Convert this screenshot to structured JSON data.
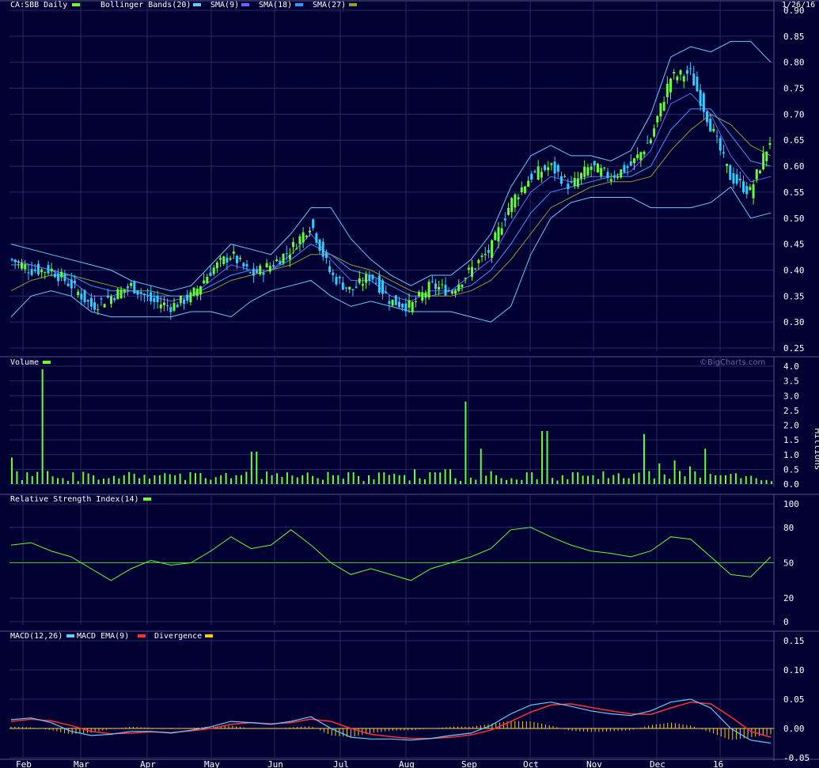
{
  "header": {
    "symbol_label": "CA:SBB Daily",
    "date": "1/26/16",
    "watermark": "©BigCharts.com"
  },
  "colors": {
    "background": "#000033",
    "grid": "#2a2a66",
    "separator": "#555588",
    "up": "#66ff33",
    "down": "#33ccff",
    "bollinger": "#66ccff",
    "sma9": "#6666ff",
    "sma18": "#3399ff",
    "sma27": "#999933",
    "volume": "#66ff33",
    "rsi": "#66ff33",
    "rsi_mid": "#33cc33",
    "macd": "#66ccff",
    "macd_ema": "#ff3333",
    "divergence": "#ffcc00"
  },
  "legends": {
    "price": [
      "Bollinger Bands(20)",
      "SMA(9)",
      "SMA(18)",
      "SMA(27)"
    ],
    "volume": "Volume",
    "rsi": "Relative Strength Index(14)",
    "macd": [
      "MACD(12,26)",
      "MACD EMA(9)",
      "Divergence"
    ],
    "volume_unit": "Millions"
  },
  "x_axis": {
    "months": [
      "Feb",
      "Mar",
      "Apr",
      "May",
      "Jun",
      "Jul",
      "Aug",
      "Sep",
      "Oct",
      "Nov",
      "Dec",
      "16"
    ]
  },
  "chart_data": [
    {
      "type": "line",
      "panel": "price",
      "title": "CA:SBB Daily",
      "x": [
        "Feb",
        "Mar",
        "Apr",
        "May",
        "Jun",
        "Jul",
        "Aug",
        "Sep",
        "Oct",
        "Nov",
        "Dec",
        "16"
      ],
      "ylim": [
        0.25,
        0.9
      ],
      "yticks": [
        "0.90",
        "0.85",
        "0.80",
        "0.75",
        "0.70",
        "0.65",
        "0.60",
        "0.55",
        "0.50",
        "0.45",
        "0.40",
        "0.35",
        "0.30",
        "0.25"
      ],
      "grid": true,
      "series": [
        {
          "name": "Close",
          "values": [
            0.42,
            0.4,
            0.4,
            0.37,
            0.33,
            0.35,
            0.37,
            0.34,
            0.33,
            0.35,
            0.4,
            0.43,
            0.39,
            0.41,
            0.44,
            0.49,
            0.39,
            0.36,
            0.39,
            0.34,
            0.33,
            0.37,
            0.36,
            0.4,
            0.44,
            0.53,
            0.58,
            0.6,
            0.56,
            0.6,
            0.58,
            0.6,
            0.65,
            0.77,
            0.78,
            0.68,
            0.58,
            0.55,
            0.65
          ]
        },
        {
          "name": "SMA(9)",
          "values": [
            0.42,
            0.41,
            0.4,
            0.38,
            0.35,
            0.35,
            0.36,
            0.35,
            0.34,
            0.35,
            0.38,
            0.41,
            0.4,
            0.4,
            0.43,
            0.47,
            0.42,
            0.38,
            0.38,
            0.35,
            0.34,
            0.36,
            0.36,
            0.39,
            0.42,
            0.49,
            0.55,
            0.58,
            0.57,
            0.58,
            0.58,
            0.59,
            0.63,
            0.72,
            0.74,
            0.7,
            0.62,
            0.57,
            0.58
          ]
        },
        {
          "name": "SMA(18)",
          "values": [
            0.41,
            0.41,
            0.4,
            0.39,
            0.37,
            0.36,
            0.36,
            0.35,
            0.35,
            0.35,
            0.37,
            0.39,
            0.4,
            0.4,
            0.42,
            0.45,
            0.43,
            0.4,
            0.39,
            0.37,
            0.35,
            0.35,
            0.36,
            0.37,
            0.4,
            0.45,
            0.51,
            0.55,
            0.56,
            0.57,
            0.58,
            0.58,
            0.6,
            0.67,
            0.71,
            0.71,
            0.66,
            0.61,
            0.6
          ]
        },
        {
          "name": "SMA(27)",
          "values": [
            0.36,
            0.38,
            0.39,
            0.39,
            0.38,
            0.37,
            0.36,
            0.36,
            0.35,
            0.35,
            0.36,
            0.38,
            0.39,
            0.4,
            0.41,
            0.43,
            0.43,
            0.41,
            0.4,
            0.38,
            0.36,
            0.35,
            0.35,
            0.36,
            0.38,
            0.42,
            0.47,
            0.52,
            0.54,
            0.56,
            0.57,
            0.57,
            0.58,
            0.63,
            0.67,
            0.7,
            0.68,
            0.64,
            0.62
          ]
        },
        {
          "name": "Bollinger Upper",
          "values": [
            0.45,
            0.44,
            0.43,
            0.42,
            0.41,
            0.4,
            0.38,
            0.37,
            0.36,
            0.37,
            0.41,
            0.45,
            0.44,
            0.43,
            0.47,
            0.52,
            0.52,
            0.46,
            0.42,
            0.39,
            0.37,
            0.39,
            0.39,
            0.42,
            0.47,
            0.56,
            0.62,
            0.64,
            0.62,
            0.62,
            0.61,
            0.63,
            0.7,
            0.81,
            0.83,
            0.82,
            0.84,
            0.84,
            0.8
          ]
        },
        {
          "name": "Bollinger Lower",
          "values": [
            0.31,
            0.35,
            0.36,
            0.35,
            0.32,
            0.31,
            0.31,
            0.31,
            0.31,
            0.32,
            0.32,
            0.31,
            0.34,
            0.36,
            0.37,
            0.38,
            0.35,
            0.33,
            0.34,
            0.33,
            0.32,
            0.32,
            0.32,
            0.31,
            0.3,
            0.33,
            0.43,
            0.5,
            0.53,
            0.54,
            0.54,
            0.54,
            0.52,
            0.52,
            0.52,
            0.53,
            0.56,
            0.5,
            0.51
          ]
        }
      ]
    },
    {
      "type": "bar",
      "panel": "volume",
      "title": "Volume",
      "ylabel": "Millions",
      "ylim": [
        0,
        4
      ],
      "yticks": [
        "4.0",
        "3.5",
        "3.0",
        "2.5",
        "2.0",
        "1.5",
        "1.0",
        "0.5",
        "0.0"
      ],
      "values": [
        0.9,
        0.4,
        3.9,
        0.2,
        0.1,
        0.3,
        0.2,
        0.3,
        0.2,
        0.3,
        0.3,
        0.4,
        0.2,
        0.3,
        0.3,
        1.1,
        0.3,
        0.4,
        0.3,
        0.2,
        0.3,
        0.4,
        0.3,
        0.4,
        0.3,
        0.5,
        0.4,
        0.5,
        2.8,
        1.2,
        0.3,
        0.2,
        0.4,
        1.8,
        0.3,
        0.4,
        0.3,
        0.2,
        0.2,
        1.7,
        0.7,
        0.8,
        0.6,
        1.2,
        0.3,
        0.2,
        0.2,
        0.1
      ]
    },
    {
      "type": "line",
      "panel": "rsi",
      "title": "Relative Strength Index(14)",
      "ylim": [
        0,
        100
      ],
      "yticks": [
        "100",
        "80",
        "50",
        "20",
        "0"
      ],
      "series": [
        {
          "name": "Relative Strength Index(14)",
          "values": [
            65,
            67,
            60,
            55,
            45,
            35,
            45,
            52,
            48,
            50,
            60,
            72,
            62,
            65,
            78,
            65,
            50,
            40,
            45,
            40,
            35,
            45,
            50,
            55,
            62,
            78,
            80,
            72,
            65,
            60,
            58,
            55,
            60,
            72,
            70,
            55,
            40,
            38,
            55
          ]
        }
      ]
    },
    {
      "type": "line",
      "panel": "macd",
      "title": "MACD(12,26)",
      "ylim": [
        -0.05,
        0.15
      ],
      "yticks": [
        "0.15",
        "0.10",
        "0.05",
        "0.00",
        "-0.05"
      ],
      "series": [
        {
          "name": "MACD(12,26)",
          "values": [
            0.015,
            0.018,
            0.01,
            -0.005,
            -0.012,
            -0.01,
            -0.005,
            -0.005,
            -0.008,
            -0.003,
            0.003,
            0.012,
            0.01,
            0.007,
            0.012,
            0.02,
            0.0,
            -0.015,
            -0.018,
            -0.018,
            -0.02,
            -0.017,
            -0.012,
            -0.008,
            0.005,
            0.025,
            0.04,
            0.045,
            0.038,
            0.03,
            0.025,
            0.022,
            0.03,
            0.045,
            0.05,
            0.035,
            0.0,
            -0.02,
            -0.025
          ]
        },
        {
          "name": "MACD EMA(9)",
          "values": [
            0.012,
            0.016,
            0.013,
            0.005,
            -0.005,
            -0.009,
            -0.008,
            -0.006,
            -0.007,
            -0.004,
            0.0,
            0.007,
            0.01,
            0.008,
            0.01,
            0.016,
            0.012,
            0.0,
            -0.01,
            -0.014,
            -0.017,
            -0.017,
            -0.015,
            -0.011,
            -0.003,
            0.012,
            0.028,
            0.04,
            0.042,
            0.036,
            0.03,
            0.025,
            0.024,
            0.035,
            0.045,
            0.042,
            0.02,
            -0.005,
            -0.015
          ]
        },
        {
          "name": "Divergence",
          "values": [
            0.003,
            0.002,
            -0.003,
            -0.01,
            -0.007,
            -0.001,
            0.003,
            0.001,
            -0.001,
            0.001,
            0.003,
            0.005,
            0.0,
            -0.001,
            0.002,
            0.004,
            -0.012,
            -0.015,
            -0.008,
            -0.004,
            -0.003,
            0.0,
            0.003,
            0.003,
            0.008,
            0.013,
            0.012,
            0.005,
            -0.004,
            -0.006,
            -0.005,
            -0.003,
            0.006,
            0.01,
            0.005,
            -0.007,
            -0.02,
            -0.015,
            -0.01
          ]
        }
      ]
    }
  ]
}
